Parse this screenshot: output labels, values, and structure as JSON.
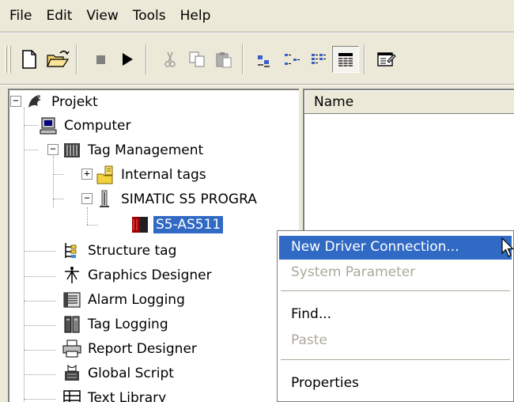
{
  "menubar": {
    "items": [
      "File",
      "Edit",
      "View",
      "Tools",
      "Help"
    ]
  },
  "toolbar": {
    "buttons": [
      "new-icon",
      "open-icon",
      "stop-icon",
      "run-icon",
      "cut-icon",
      "copy-icon",
      "paste-icon",
      "large-icons-icon",
      "small-icons-icon",
      "list-icon",
      "details-icon",
      "properties-icon"
    ]
  },
  "tree": {
    "items": [
      {
        "label": "Projekt",
        "icon": "project-icon"
      },
      {
        "label": "Computer",
        "icon": "computer-icon"
      },
      {
        "label": "Tag Management",
        "icon": "tag-management-icon"
      },
      {
        "label": "Internal tags",
        "icon": "internal-tags-icon"
      },
      {
        "label": "SIMATIC S5 PROGRA",
        "icon": "plc-icon"
      },
      {
        "label": "S5-AS511",
        "icon": "connection-icon",
        "selected": true
      },
      {
        "label": "Structure tag",
        "icon": "structure-tag-icon"
      },
      {
        "label": "Graphics Designer",
        "icon": "graphics-designer-icon"
      },
      {
        "label": "Alarm Logging",
        "icon": "alarm-logging-icon"
      },
      {
        "label": "Tag Logging",
        "icon": "tag-logging-icon"
      },
      {
        "label": "Report Designer",
        "icon": "report-designer-icon"
      },
      {
        "label": "Global Script",
        "icon": "global-script-icon"
      },
      {
        "label": "Text Library",
        "icon": "text-library-icon"
      }
    ]
  },
  "list": {
    "column_header": "Name"
  },
  "context_menu": {
    "items": [
      {
        "label": "New Driver Connection...",
        "state": "highlighted"
      },
      {
        "label": "System Parameter",
        "state": "disabled"
      },
      {
        "label": "Find...",
        "state": "enabled"
      },
      {
        "label": "Paste",
        "state": "disabled"
      },
      {
        "label": "Properties",
        "state": "enabled"
      }
    ]
  },
  "colors": {
    "selection": "#316ac5",
    "chrome": "#ece9d8",
    "disabled_text": "#aca899"
  }
}
